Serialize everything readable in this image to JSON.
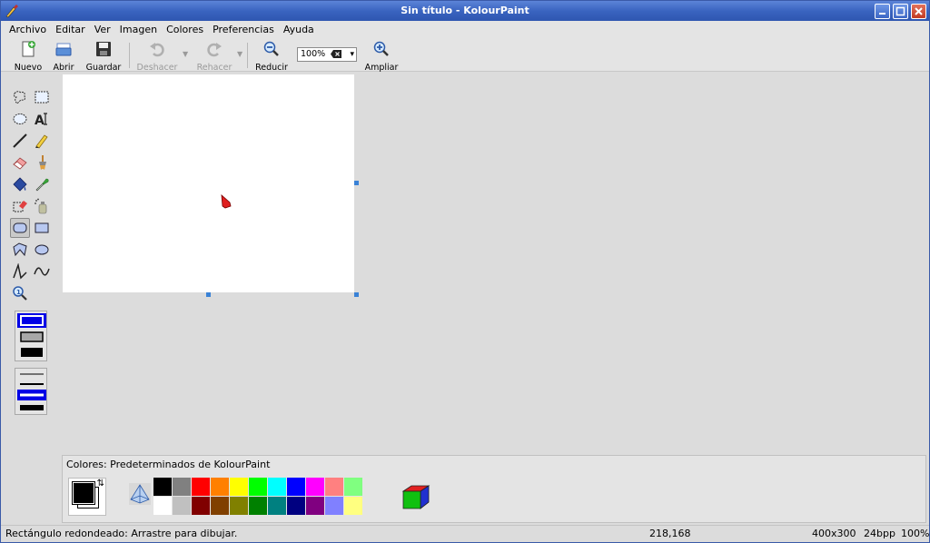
{
  "window": {
    "title": "Sin título - KolourPaint"
  },
  "menubar": {
    "items": [
      {
        "label": "Archivo"
      },
      {
        "label": "Editar"
      },
      {
        "label": "Ver"
      },
      {
        "label": "Imagen"
      },
      {
        "label": "Colores"
      },
      {
        "label": "Preferencias"
      },
      {
        "label": "Ayuda"
      }
    ]
  },
  "toolbar": {
    "new_label": "Nuevo",
    "open_label": "Abrir",
    "save_label": "Guardar",
    "undo_label": "Deshacer",
    "redo_label": "Rehacer",
    "zoom_out_label": "Reducir",
    "zoom_value": "100%",
    "zoom_in_label": "Ampliar"
  },
  "tools": [
    {
      "icon": "free-form-selection-icon"
    },
    {
      "icon": "rectangular-selection-icon"
    },
    {
      "icon": "elliptical-selection-icon"
    },
    {
      "icon": "text-icon",
      "glyph": "A"
    },
    {
      "icon": "line-icon"
    },
    {
      "icon": "pen-icon"
    },
    {
      "icon": "eraser-icon"
    },
    {
      "icon": "brush-icon"
    },
    {
      "icon": "flood-fill-icon"
    },
    {
      "icon": "color-picker-icon"
    },
    {
      "icon": "color-eraser-icon"
    },
    {
      "icon": "spraycan-icon"
    },
    {
      "icon": "rounded-rectangle-icon",
      "active": true
    },
    {
      "icon": "rectangle-icon"
    },
    {
      "icon": "polygon-icon"
    },
    {
      "icon": "ellipse-icon"
    },
    {
      "icon": "connected-lines-icon"
    },
    {
      "icon": "curve-icon"
    },
    {
      "icon": "zoom-icon"
    }
  ],
  "fill_options": {
    "selected_index": 0
  },
  "line_width_options": {
    "selected_index": 1
  },
  "colors": {
    "label": "Colores: Predeterminados de KolourPaint",
    "foreground": "#000000",
    "background": "#ffffff",
    "palette_row1": [
      "#000000",
      "#808080",
      "#ff0000",
      "#ff8000",
      "#ffff00",
      "#00ff00",
      "#00ffff",
      "#0000ff",
      "#ff00ff",
      "#ff8080",
      "#80ff80",
      "#e4e4e4"
    ],
    "palette_row2": [
      "#ffffff",
      "#c0c0c0",
      "#800000",
      "#804000",
      "#808000",
      "#008000",
      "#008080",
      "#000080",
      "#800080",
      "#8080ff",
      "#ffff80",
      "#e4e4e4"
    ]
  },
  "canvas": {
    "background": "#ffffff"
  },
  "statusbar": {
    "message": "Rectángulo redondeado: Arrastre para dibujar.",
    "coords": "218,168",
    "size": "400x300",
    "depth": "24bpp",
    "zoom": "100%"
  }
}
